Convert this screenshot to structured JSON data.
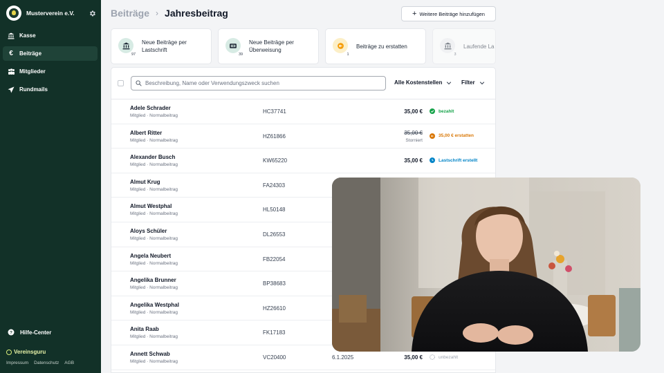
{
  "sidebar": {
    "org_name": "Musterverein e.V.",
    "items": [
      {
        "label": "Kasse",
        "icon": "bank-icon",
        "active": false
      },
      {
        "label": "Beiträge",
        "icon": "euro-icon",
        "active": true
      },
      {
        "label": "Mitglieder",
        "icon": "members-icon",
        "active": false
      },
      {
        "label": "Rundmails",
        "icon": "send-icon",
        "active": false
      }
    ],
    "help_label": "Hilfe-Center",
    "brand": "Vereinsguru",
    "footer_links": [
      "Impressum",
      "Datenschutz",
      "AGB"
    ]
  },
  "header": {
    "parent": "Beiträge",
    "current": "Jahresbeitrag",
    "add_button": "Weitere Beiträge hinzufügen"
  },
  "cards": [
    {
      "label": "Neue Beiträge per Lastschrift",
      "count": "97",
      "icon": "bank-icon",
      "color": "#d7ebe4"
    },
    {
      "label": "Neue Beiträge per Überweisung",
      "count": "39",
      "icon": "transfer-icon",
      "color": "#d7ebe4"
    },
    {
      "label": "Beiträge zu erstatten",
      "count": "1",
      "icon": "refund-icon",
      "color": "#fcefc7"
    },
    {
      "label": "Laufende La",
      "count": "3",
      "icon": "bank-icon",
      "color": "#eef0f2"
    }
  ],
  "toolbar": {
    "search_placeholder": "Beschreibung, Name oder Verwendungszweck suchen",
    "cost_center": "Alle Kostenstellen",
    "filter": "Filter"
  },
  "rows": [
    {
      "name": "Adele Schrader",
      "sub": "Mitglied · Normalbeitrag",
      "ref": "HC37741",
      "date": "",
      "amount": "35,00 €",
      "status": "bezahlt",
      "status_type": "paid"
    },
    {
      "name": "Albert Ritter",
      "sub": "Mitglied · Normalbeitrag",
      "ref": "HZ61866",
      "date": "",
      "amount": "35,00 €",
      "amount_note": "Storniert",
      "status": "35,00 € erstatten",
      "status_type": "refund"
    },
    {
      "name": "Alexander Busch",
      "sub": "Mitglied · Normalbeitrag",
      "ref": "KW65220",
      "date": "",
      "amount": "35,00 €",
      "status": "Lastschrift erstellt",
      "status_type": "debit"
    },
    {
      "name": "Almut Krug",
      "sub": "Mitglied · Normalbeitrag",
      "ref": "FA24303",
      "date": "",
      "amount": "",
      "status": "",
      "status_type": ""
    },
    {
      "name": "Almut Westphal",
      "sub": "Mitglied · Normalbeitrag",
      "ref": "HL50148",
      "date": "",
      "amount": "",
      "status": "",
      "status_type": ""
    },
    {
      "name": "Aloys Schüler",
      "sub": "Mitglied · Normalbeitrag",
      "ref": "DL26553",
      "date": "",
      "amount": "",
      "status": "",
      "status_type": ""
    },
    {
      "name": "Angela Neubert",
      "sub": "Mitglied · Normalbeitrag",
      "ref": "FB22054",
      "date": "",
      "amount": "",
      "status": "",
      "status_type": ""
    },
    {
      "name": "Angelika Brunner",
      "sub": "Mitglied · Normalbeitrag",
      "ref": "BP38683",
      "date": "",
      "amount": "",
      "status": "",
      "status_type": ""
    },
    {
      "name": "Angelika Westphal",
      "sub": "Mitglied · Normalbeitrag",
      "ref": "HZ26610",
      "date": "",
      "amount": "",
      "status": "",
      "status_type": ""
    },
    {
      "name": "Anita Raab",
      "sub": "Mitglied · Normalbeitrag",
      "ref": "FK17183",
      "date": "",
      "amount": "",
      "status": "",
      "status_type": ""
    },
    {
      "name": "Annett Schwab",
      "sub": "Mitglied · Normalbeitrag",
      "ref": "VC20400",
      "date": "6.1.2025",
      "amount": "35,00 €",
      "status": "unbezahlt",
      "status_type": "unpaid"
    }
  ],
  "status_colors": {
    "paid": "#16a34a",
    "refund": "#d97706",
    "debit": "#0284c7",
    "unpaid": "#9ca3af"
  }
}
